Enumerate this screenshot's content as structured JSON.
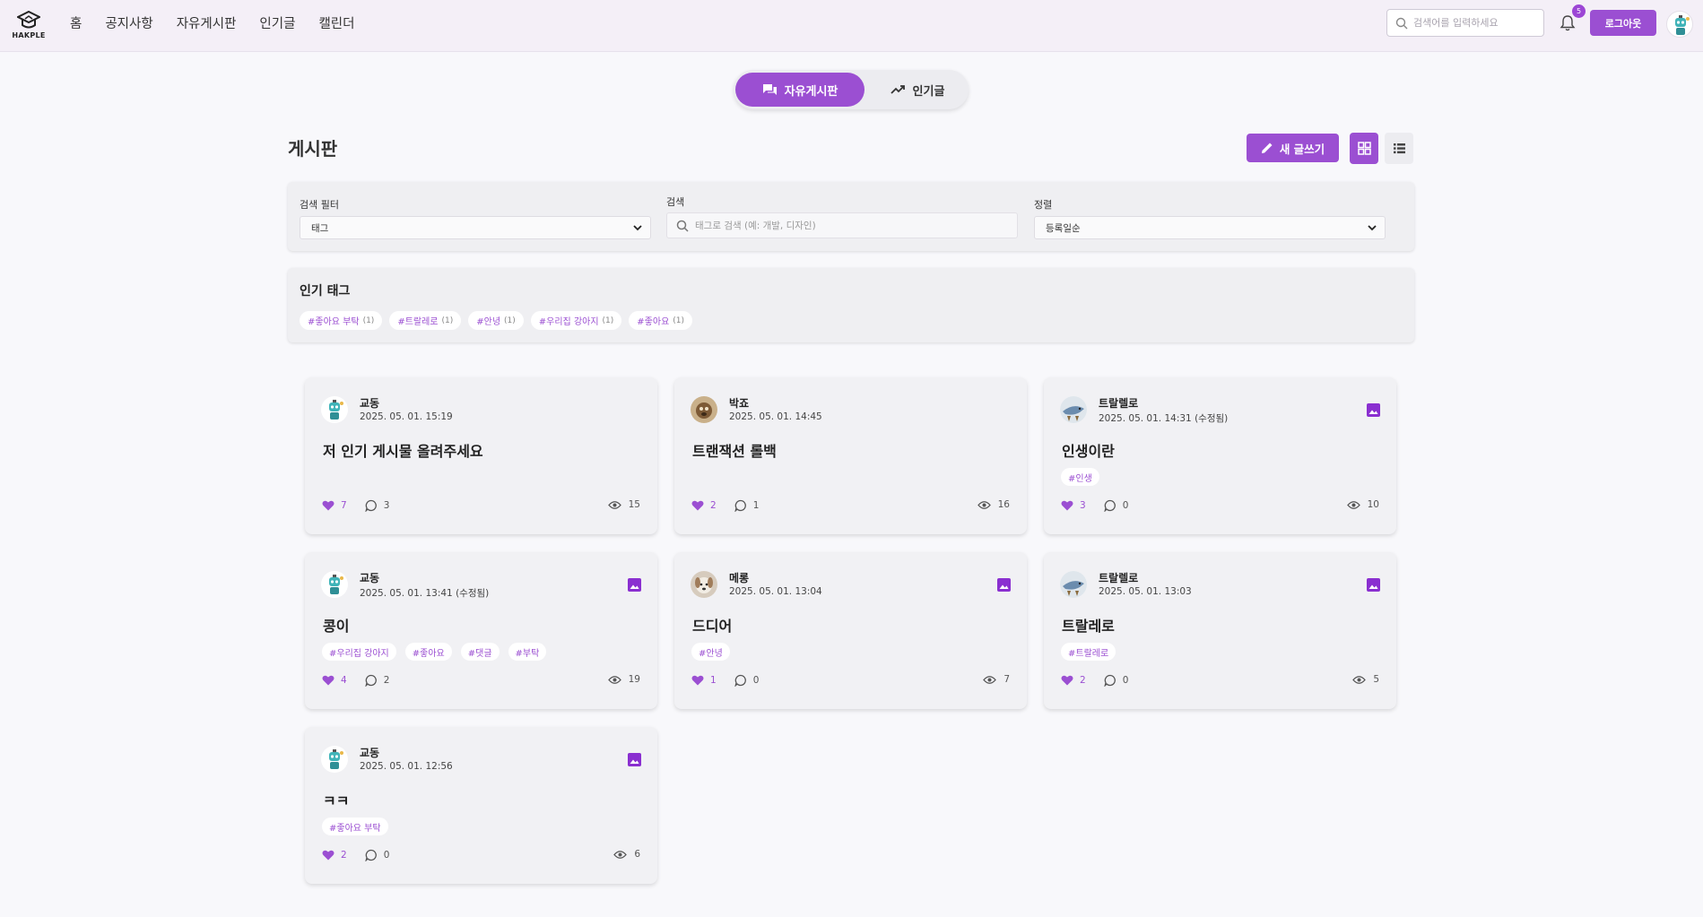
{
  "header": {
    "logo_text": "HAKPLE",
    "nav": [
      "홈",
      "공지사항",
      "자유게시판",
      "인기글",
      "캘린더"
    ],
    "search_placeholder": "검색어를 입력하세요",
    "notification_count": "5",
    "logout_label": "로그아웃"
  },
  "toggle": {
    "free_board": "자유게시판",
    "popular": "인기글"
  },
  "page": {
    "title": "게시판",
    "new_post_label": "새 글쓰기"
  },
  "filters": {
    "filter_label": "검색 필터",
    "filter_value": "태그",
    "search_label": "검색",
    "search_placeholder": "태그로 검색 (예: 개발, 디자인)",
    "sort_label": "정렬",
    "sort_value": "등록일순"
  },
  "popular_tags": {
    "title": "인기 태그",
    "tags": [
      {
        "name": "#좋아요 부탁",
        "count": "(1)"
      },
      {
        "name": "#트랄레로",
        "count": "(1)"
      },
      {
        "name": "#안녕",
        "count": "(1)"
      },
      {
        "name": "#우리집 강아지",
        "count": "(1)"
      },
      {
        "name": "#좋아요",
        "count": "(1)"
      }
    ]
  },
  "posts": [
    {
      "author": "교동",
      "date": "2025. 05. 01. 15:19",
      "title": "저 인기 게시물 올려주세요",
      "tags": [],
      "likes": "7",
      "comments": "3",
      "views": "15",
      "has_image": false,
      "avatar": "robot"
    },
    {
      "author": "박죠",
      "date": "2025. 05. 01. 14:45",
      "title": "트랜잭션 롤백",
      "tags": [],
      "likes": "2",
      "comments": "1",
      "views": "16",
      "has_image": false,
      "avatar": "animal"
    },
    {
      "author": "트랄렐로",
      "date": "2025. 05. 01. 14:31 (수정됨)",
      "title": "인생이란",
      "tags": [
        "#인생"
      ],
      "likes": "3",
      "comments": "0",
      "views": "10",
      "has_image": true,
      "avatar": "shark"
    },
    {
      "author": "교동",
      "date": "2025. 05. 01. 13:41 (수정됨)",
      "title": "콩이",
      "tags": [
        "#우리집 강아지",
        "#좋아요",
        "#댓글",
        "#부탁"
      ],
      "likes": "4",
      "comments": "2",
      "views": "19",
      "has_image": true,
      "avatar": "robot"
    },
    {
      "author": "메롱",
      "date": "2025. 05. 01. 13:04",
      "title": "드디어",
      "tags": [
        "#안녕"
      ],
      "likes": "1",
      "comments": "0",
      "views": "7",
      "has_image": true,
      "avatar": "dog"
    },
    {
      "author": "트랄렐로",
      "date": "2025. 05. 01. 13:03",
      "title": "트랄레로",
      "tags": [
        "#트랄레로"
      ],
      "likes": "2",
      "comments": "0",
      "views": "5",
      "has_image": true,
      "avatar": "shark"
    },
    {
      "author": "교동",
      "date": "2025. 05. 01. 12:56",
      "title": "ㅋㅋ",
      "tags": [
        "#좋아요 부탁"
      ],
      "likes": "2",
      "comments": "0",
      "views": "6",
      "has_image": true,
      "avatar": "robot"
    }
  ],
  "colors": {
    "accent": "#9b4fd2",
    "background": "#f8f8fb",
    "card": "#f1f1f4"
  }
}
